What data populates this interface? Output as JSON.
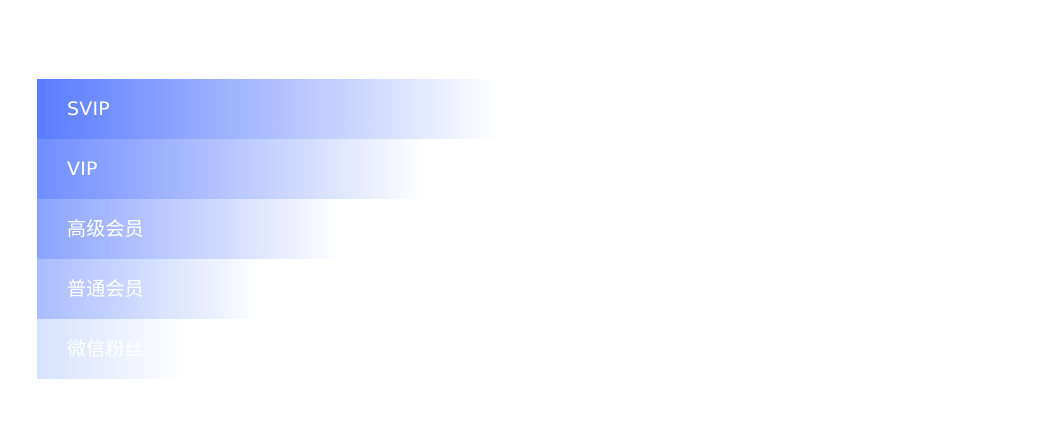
{
  "tiers": [
    {
      "label": "SVIP",
      "color": "#5a7cff"
    },
    {
      "label": "VIP",
      "color": "#6f8dff"
    },
    {
      "label": "高级会员",
      "color": "#8aa3ff"
    },
    {
      "label": "普通会员",
      "color": "#a8bcff"
    },
    {
      "label": "微信粉丝",
      "color": "#d7e1ff"
    }
  ]
}
